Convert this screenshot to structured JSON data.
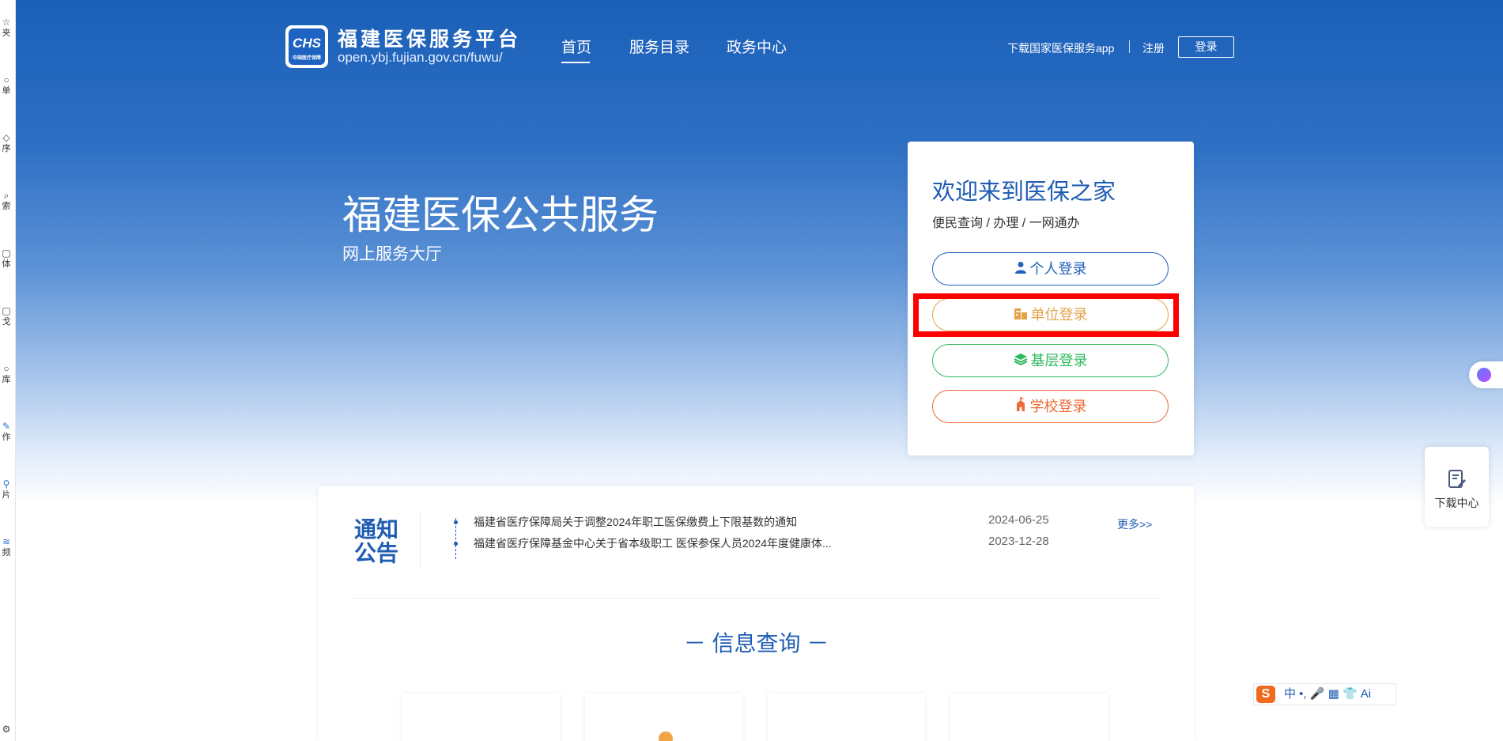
{
  "sidebar": {
    "items": [
      {
        "icon": "☆",
        "label": "夹"
      },
      {
        "icon": "○",
        "label": "单"
      },
      {
        "icon": "◇",
        "label": "序"
      },
      {
        "icon": "⌕",
        "label": "索"
      },
      {
        "icon": "▢",
        "label": "体"
      },
      {
        "icon": "▢",
        "label": "戈"
      },
      {
        "icon": "○",
        "label": "库"
      },
      {
        "icon": "✎",
        "label": "作"
      },
      {
        "icon": "⚲",
        "label": "片"
      },
      {
        "icon": "≋",
        "label": "频"
      },
      {
        "icon": "⚙",
        "label": ""
      }
    ]
  },
  "header": {
    "logo_text": "CHS",
    "logo_caption": "中国医疗保障",
    "title": "福建医保服务平台",
    "url": "open.ybj.fujian.gov.cn/fuwu/",
    "nav": [
      "首页",
      "服务目录",
      "政务中心"
    ],
    "download_app": "下载国家医保服务app",
    "register": "注册",
    "login": "登录"
  },
  "hero": {
    "title": "福建医保公共服务",
    "subtitle": "网上服务大厅"
  },
  "login_card": {
    "title": "欢迎来到医保之家",
    "subtitle": "便民查询 / 办理 / 一网通办",
    "buttons": [
      {
        "label": "个人登录",
        "icon": "person-icon",
        "color": "#2162bd"
      },
      {
        "label": "单位登录",
        "icon": "building-icon",
        "color": "#e3a348"
      },
      {
        "label": "基层登录",
        "icon": "layers-icon",
        "color": "#2db95d"
      },
      {
        "label": "学校登录",
        "icon": "school-icon",
        "color": "#ec6a35"
      }
    ]
  },
  "notice": {
    "title_line1": "通知",
    "title_line2": "公告",
    "items": [
      {
        "text": "福建省医疗保障局关于调整2024年职工医保缴费上下限基数的通知",
        "date": "2024-06-25"
      },
      {
        "text": "福建省医疗保障基金中心关于省本级职工 医保参保人员2024年度健康体...",
        "date": "2023-12-28"
      }
    ],
    "more": "更多>>"
  },
  "info_query": {
    "title": "－ 信息查询 －"
  },
  "floating": {
    "download_center": "下载中心"
  },
  "ime": {
    "logo": "S",
    "text": "中 •, 🎤 ▦ 👕 Ai"
  },
  "colors": {
    "brand_blue": "#1f5cb4",
    "highlight_red": "#ff0000"
  }
}
